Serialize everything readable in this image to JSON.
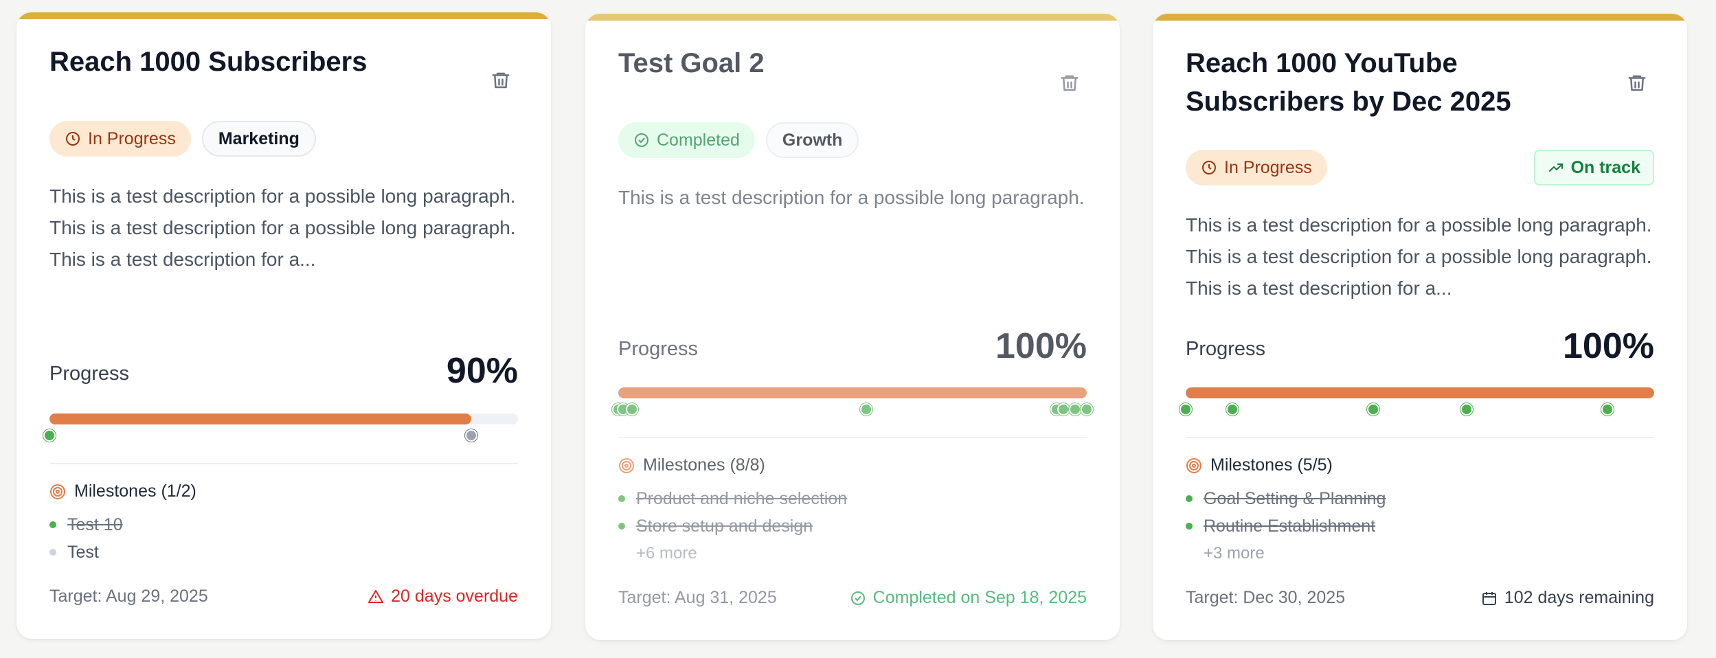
{
  "goals": [
    {
      "title": "Reach 1000 Subscribers",
      "status_badge": "In Progress",
      "category": "Marketing",
      "description": "This is a test description for a possible long paragraph. This is a test description for a possible long paragraph. This is a test description for a...",
      "progress_label": "Progress",
      "progress_pct_text": "90%",
      "progress_fraction": 0.9,
      "milestone_markers": [
        {
          "position": 0.0,
          "done": true
        },
        {
          "position": 0.9,
          "done": false
        }
      ],
      "milestones_heading": "Milestones (1/2)",
      "milestones": [
        {
          "label": "Test 10",
          "done": true
        },
        {
          "label": "Test",
          "done": false
        }
      ],
      "target": "Target: Aug 29, 2025",
      "deadline_status": "20 days overdue"
    },
    {
      "title": "Test Goal 2",
      "status_badge": "Completed",
      "category": "Growth",
      "description": "This is a test description for a possible long paragraph.",
      "progress_label": "Progress",
      "progress_pct_text": "100%",
      "progress_fraction": 1.0,
      "milestone_markers": [
        {
          "position": 0.0,
          "done": true
        },
        {
          "position": 0.01,
          "done": true
        },
        {
          "position": 0.03,
          "done": true
        },
        {
          "position": 0.53,
          "done": true
        },
        {
          "position": 0.935,
          "done": true
        },
        {
          "position": 0.95,
          "done": true
        },
        {
          "position": 0.975,
          "done": true
        },
        {
          "position": 1.0,
          "done": true
        }
      ],
      "milestones_heading": "Milestones (8/8)",
      "milestones": [
        {
          "label": "Product and niche selection",
          "done": true
        },
        {
          "label": "Store setup and design",
          "done": true
        }
      ],
      "more": "+6 more",
      "target": "Target: Aug 31, 2025",
      "deadline_status": "Completed on Sep 18, 2025"
    },
    {
      "title": "Reach 1000 YouTube Subscribers by Dec 2025",
      "status_badge": "In Progress",
      "trend_badge": "On track",
      "description": "This is a test description for a possible long paragraph. This is a test description for a possible long paragraph. This is a test description for a...",
      "progress_label": "Progress",
      "progress_pct_text": "100%",
      "progress_fraction": 1.0,
      "milestone_markers": [
        {
          "position": 0.0,
          "done": true
        },
        {
          "position": 0.1,
          "done": true
        },
        {
          "position": 0.4,
          "done": true
        },
        {
          "position": 0.6,
          "done": true
        },
        {
          "position": 0.9,
          "done": true
        }
      ],
      "milestones_heading": "Milestones (5/5)",
      "milestones": [
        {
          "label": "Goal Setting & Planning",
          "done": true
        },
        {
          "label": "Routine Establishment",
          "done": true
        }
      ],
      "more": "+3 more",
      "target": "Target: Dec 30, 2025",
      "deadline_status": "102 days remaining"
    }
  ],
  "colors": {
    "accent_top": "#dcae3a",
    "progress_fill": "#e07e4a",
    "success": "#16a34a",
    "danger": "#dc2626"
  },
  "icons": {
    "delete": "trash-icon",
    "in_progress": "clock-icon",
    "completed": "check-circle-icon",
    "milestones": "target-icon",
    "overdue": "alert-triangle-icon",
    "on_track": "trending-up-icon",
    "remaining": "calendar-icon"
  }
}
